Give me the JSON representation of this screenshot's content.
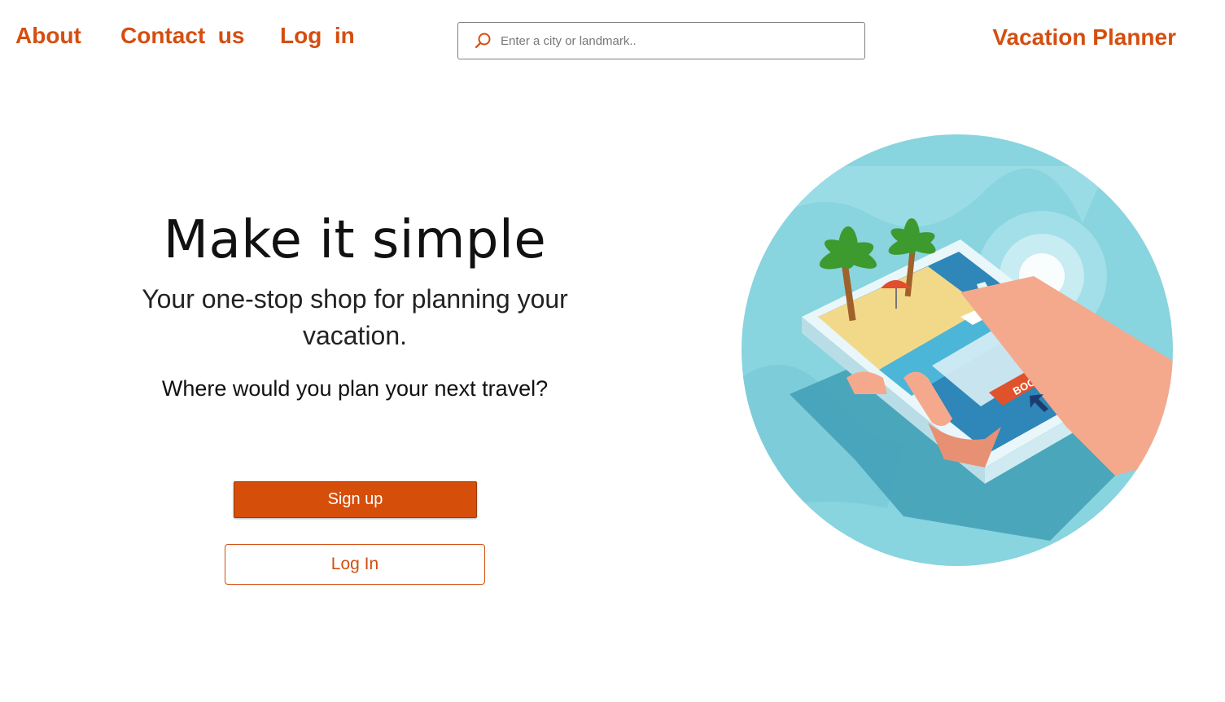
{
  "nav": {
    "about": "About",
    "contact": "Contact  us",
    "login": "Log  in"
  },
  "brand": "Vacation Planner",
  "search": {
    "placeholder": "Enter a city or landmark..",
    "value": "",
    "icon": "search-icon"
  },
  "hero": {
    "title": "Make it simple",
    "subtitle": "Your one-stop shop for planning your vacation.",
    "question": "Where would you plan your next travel?"
  },
  "buttons": {
    "signup": "Sign up",
    "login": "Log In"
  },
  "illustration": {
    "button_text": "BOOK NOW"
  },
  "colors": {
    "accent": "#d54e10",
    "signup_bg": "#d54e0a",
    "illustration_bg": "#88d4df"
  }
}
